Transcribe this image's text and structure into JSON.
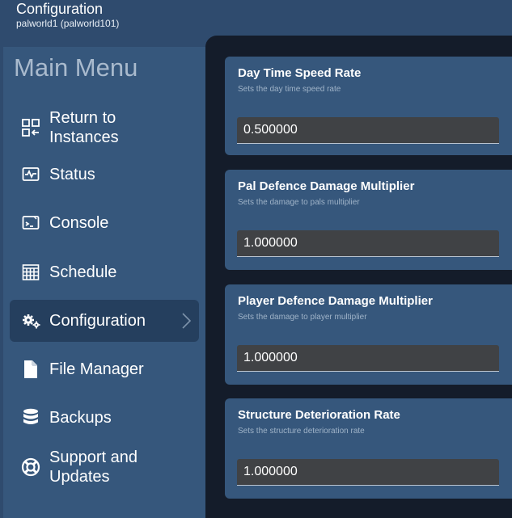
{
  "header": {
    "title": "Configuration",
    "subtitle": "palworld1 (palworld101)"
  },
  "sidebar": {
    "title": "Main Menu",
    "items": [
      {
        "label_line1": "Return to",
        "label_line2": "Instances",
        "icon": "return-to-instances-icon"
      },
      {
        "label": "Status",
        "icon": "status-icon"
      },
      {
        "label": "Console",
        "icon": "console-icon"
      },
      {
        "label": "Schedule",
        "icon": "schedule-icon"
      },
      {
        "label": "Configuration",
        "icon": "gears-icon",
        "active": true
      },
      {
        "label": "File Manager",
        "icon": "file-icon"
      },
      {
        "label": "Backups",
        "icon": "database-icon"
      },
      {
        "label_line1": "Support and",
        "label_line2": "Updates",
        "icon": "lifebuoy-icon"
      }
    ]
  },
  "settings": [
    {
      "title": "Day Time Speed Rate",
      "description": "Sets the day time speed rate",
      "value": "0.500000"
    },
    {
      "title": "Pal Defence Damage Multiplier",
      "description": "Sets the damage to pals multiplier",
      "value": "1.000000"
    },
    {
      "title": "Player Defence Damage Multiplier",
      "description": "Sets the damage to player multiplier",
      "value": "1.000000"
    },
    {
      "title": "Structure Deterioration Rate",
      "description": "Sets the structure deterioration rate",
      "value": "1.000000"
    }
  ],
  "colors": {
    "background": "#2f4b6e",
    "sidebar": "#36577c",
    "active_item": "#253f5e",
    "main_panel": "#141c2a",
    "input": "#404245"
  }
}
